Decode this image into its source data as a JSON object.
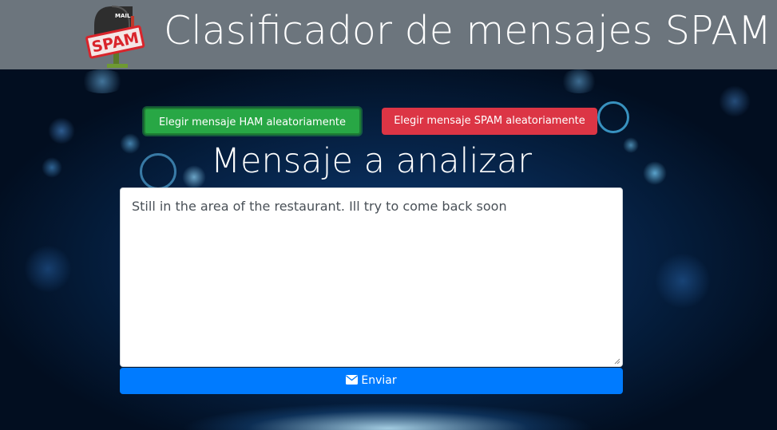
{
  "header": {
    "title": "Clasificador de mensajes SPAM",
    "logo": {
      "icon": "spam-mailbox-icon",
      "mailbox_text": "MAIL",
      "stamp_text": "SPAM"
    }
  },
  "actions": {
    "ham_label": "Elegir mensaje HAM aleatoriamente",
    "spam_label": "Elegir mensaje SPAM aleatoriamente"
  },
  "main": {
    "section_title": "Mensaje a analizar",
    "message_value": "Still in the area of the restaurant. Ill try to come back soon"
  },
  "submit": {
    "label": "Enviar",
    "icon": "envelope-icon"
  },
  "colors": {
    "header_bg": "#6c757d",
    "ham_button": "#28a745",
    "spam_button": "#dc3545",
    "send_button": "#007bff"
  }
}
